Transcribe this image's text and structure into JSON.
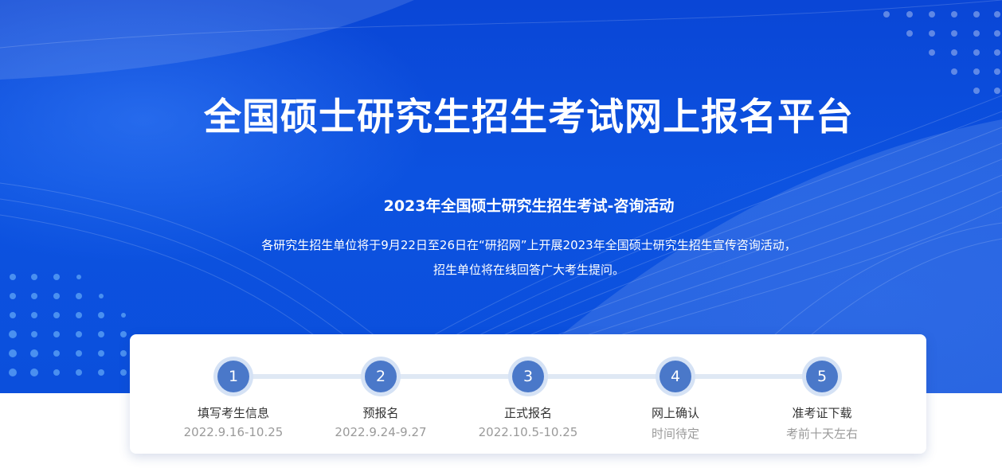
{
  "hero": {
    "title": "全国硕士研究生招生考试网上报名平台",
    "subtitle": "2023年全国硕士研究生招生考试-咨询活动",
    "description_line1": "各研究生招生单位将于9月22日至26日在“研招网”上开展2023年全国硕士研究生招生宣传咨询活动，",
    "description_line2": "招生单位将在线回答广大考生提问。"
  },
  "steps": [
    {
      "num": "1",
      "label": "填写考生信息",
      "date": "2022.9.16-10.25"
    },
    {
      "num": "2",
      "label": "预报名",
      "date": "2022.9.24-9.27"
    },
    {
      "num": "3",
      "label": "正式报名",
      "date": "2022.10.5-10.25"
    },
    {
      "num": "4",
      "label": "网上确认",
      "date": "时间待定"
    },
    {
      "num": "5",
      "label": "准考证下载",
      "date": "考前十天左右"
    }
  ],
  "colors": {
    "hero_background": "#0b4fdc",
    "step_circle": "#4a78c9",
    "step_ring": "#d5e2f5"
  }
}
